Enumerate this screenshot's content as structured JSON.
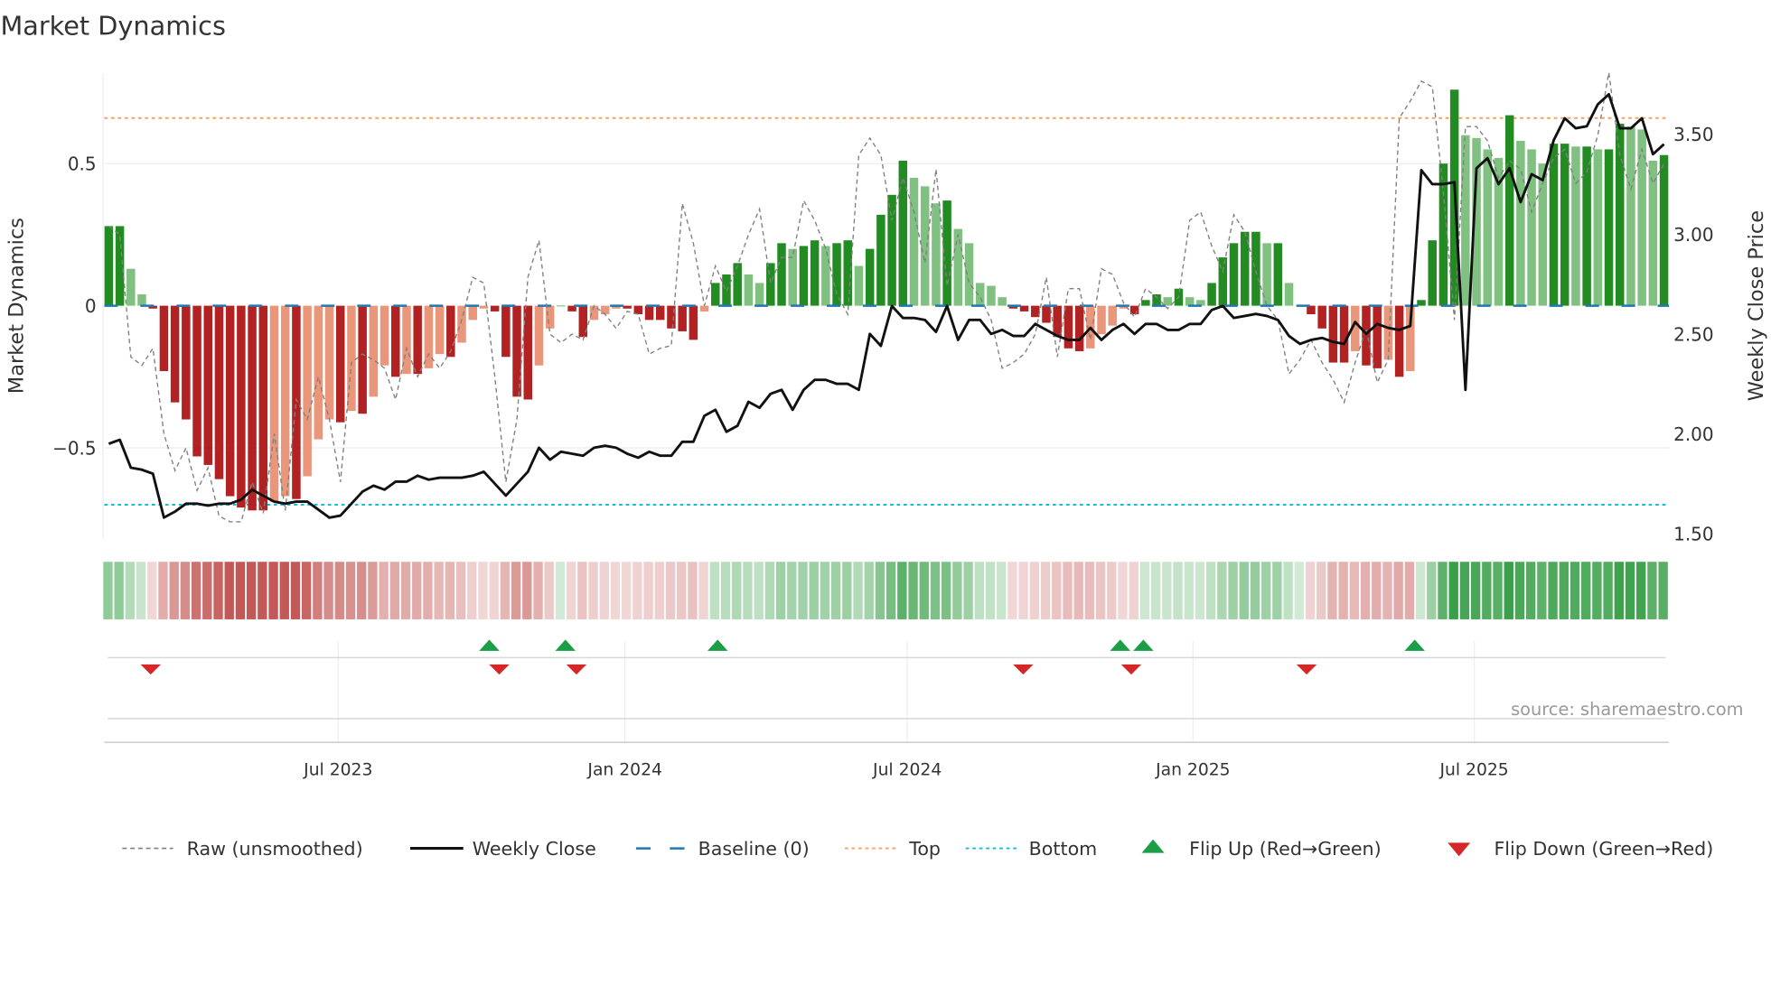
{
  "chart_data": {
    "type": "bar",
    "title": "Market Dynamics",
    "ylabel": "Market Dynamics",
    "y2label": "Weekly Close Price",
    "ylim": [
      -0.82,
      0.82
    ],
    "y2lim": [
      1.5,
      3.8
    ],
    "yticks": [
      {
        "v": 0.5,
        "label": "0.5"
      },
      {
        "v": 0,
        "label": "0"
      },
      {
        "v": -0.5,
        "label": "−0.5"
      }
    ],
    "y2ticks": [
      {
        "v": 3.5,
        "label": "3.50"
      },
      {
        "v": 3.0,
        "label": "3.00"
      },
      {
        "v": 2.5,
        "label": "2.50"
      },
      {
        "v": 2.0,
        "label": "2.00"
      },
      {
        "v": 1.5,
        "label": "1.50"
      }
    ],
    "xticks": [
      {
        "week": 20.8,
        "label": "Jul 2023"
      },
      {
        "week": 46.8,
        "label": "Jan 2024"
      },
      {
        "week": 72.4,
        "label": "Jul 2024"
      },
      {
        "week": 98.3,
        "label": "Jan 2025"
      },
      {
        "week": 123.8,
        "label": "Jul 2025"
      }
    ],
    "top_level": 0.66,
    "bottom_level": -0.7,
    "baseline": 0,
    "smoothed": [
      0.28,
      0.28,
      0.13,
      0.04,
      -0.01,
      -0.23,
      -0.34,
      -0.4,
      -0.53,
      -0.56,
      -0.61,
      -0.67,
      -0.71,
      -0.72,
      -0.72,
      -0.69,
      -0.67,
      -0.68,
      -0.6,
      -0.47,
      -0.4,
      -0.41,
      -0.37,
      -0.38,
      -0.32,
      -0.21,
      -0.25,
      -0.24,
      -0.24,
      -0.22,
      -0.17,
      -0.18,
      -0.13,
      -0.05,
      -0.01,
      -0.02,
      -0.18,
      -0.32,
      -0.33,
      -0.21,
      -0.08,
      0.0,
      -0.02,
      -0.11,
      -0.05,
      -0.03,
      -0.01,
      -0.01,
      -0.03,
      -0.05,
      -0.05,
      -0.08,
      -0.09,
      -0.12,
      -0.02,
      0.08,
      0.11,
      0.15,
      0.11,
      0.08,
      0.15,
      0.22,
      0.2,
      0.21,
      0.23,
      0.21,
      0.22,
      0.23,
      0.14,
      0.2,
      0.32,
      0.39,
      0.51,
      0.45,
      0.42,
      0.36,
      0.37,
      0.27,
      0.22,
      0.08,
      0.07,
      0.03,
      -0.01,
      -0.02,
      -0.04,
      -0.06,
      -0.11,
      -0.15,
      -0.16,
      -0.15,
      -0.1,
      -0.07,
      -0.01,
      -0.03,
      0.02,
      0.04,
      0.03,
      0.06,
      0.03,
      0.02,
      0.08,
      0.17,
      0.22,
      0.26,
      0.26,
      0.22,
      0.22,
      0.08,
      0.0,
      -0.03,
      -0.08,
      -0.2,
      -0.2,
      -0.16,
      -0.21,
      -0.22,
      -0.19,
      -0.25,
      -0.23,
      0.02,
      0.23,
      0.5,
      0.76,
      0.6,
      0.59,
      0.55,
      0.52,
      0.67,
      0.58,
      0.55,
      0.5,
      0.57,
      0.57,
      0.56,
      0.56,
      0.55,
      0.55,
      0.64,
      0.63,
      0.62,
      0.51,
      0.53
    ],
    "raw": [
      0.28,
      0.25,
      -0.18,
      -0.21,
      -0.15,
      -0.45,
      -0.58,
      -0.5,
      -0.65,
      -0.57,
      -0.74,
      -0.76,
      -0.76,
      -0.62,
      -0.73,
      -0.45,
      -0.72,
      -0.33,
      -0.4,
      -0.25,
      -0.4,
      -0.62,
      -0.2,
      -0.17,
      -0.19,
      -0.22,
      -0.33,
      -0.15,
      -0.25,
      -0.17,
      -0.22,
      -0.16,
      -0.05,
      0.1,
      0.08,
      -0.25,
      -0.62,
      -0.4,
      0.1,
      0.23,
      -0.1,
      -0.13,
      -0.1,
      -0.12,
      0.0,
      -0.03,
      -0.08,
      -0.02,
      -0.03,
      -0.17,
      -0.15,
      -0.14,
      0.36,
      0.22,
      0.0,
      0.14,
      0.05,
      0.14,
      0.25,
      0.34,
      0.08,
      0.17,
      0.17,
      0.37,
      0.3,
      0.2,
      0.04,
      -0.03,
      0.53,
      0.59,
      0.53,
      0.3,
      0.45,
      0.33,
      0.15,
      0.48,
      0.07,
      0.25,
      0.08,
      0.03,
      -0.05,
      -0.22,
      -0.2,
      -0.17,
      -0.1,
      0.1,
      -0.18,
      0.06,
      0.06,
      -0.12,
      0.13,
      0.11,
      0.01,
      -0.04,
      0.06,
      0.03,
      -0.01,
      0.03,
      0.3,
      0.33,
      0.21,
      0.12,
      0.32,
      0.26,
      0.12,
      0.0,
      -0.05,
      -0.24,
      -0.19,
      -0.12,
      -0.2,
      -0.26,
      -0.34,
      -0.2,
      -0.08,
      -0.27,
      -0.19,
      0.66,
      0.72,
      0.79,
      0.77,
      0.4,
      -0.05,
      0.63,
      0.63,
      0.58,
      0.45,
      0.51,
      0.48,
      0.33,
      0.43,
      0.52,
      0.55,
      0.43,
      0.47,
      0.6,
      0.82,
      0.53,
      0.41,
      0.55,
      0.43,
      0.5
    ],
    "weekly_close": [
      1.95,
      1.97,
      1.83,
      1.82,
      1.8,
      1.58,
      1.61,
      1.65,
      1.65,
      1.64,
      1.65,
      1.65,
      1.67,
      1.72,
      1.69,
      1.66,
      1.65,
      1.66,
      1.66,
      1.62,
      1.58,
      1.59,
      1.65,
      1.71,
      1.74,
      1.72,
      1.76,
      1.76,
      1.79,
      1.77,
      1.78,
      1.78,
      1.78,
      1.79,
      1.81,
      1.75,
      1.69,
      1.75,
      1.81,
      1.93,
      1.87,
      1.91,
      1.9,
      1.89,
      1.93,
      1.94,
      1.93,
      1.9,
      1.88,
      1.91,
      1.89,
      1.89,
      1.96,
      1.96,
      2.09,
      2.12,
      2.01,
      2.04,
      2.16,
      2.13,
      2.2,
      2.22,
      2.12,
      2.22,
      2.27,
      2.27,
      2.25,
      2.25,
      2.22,
      2.5,
      2.44,
      2.64,
      2.58,
      2.58,
      2.57,
      2.51,
      2.64,
      2.47,
      2.57,
      2.57,
      2.5,
      2.52,
      2.49,
      2.49,
      2.55,
      2.52,
      2.49,
      2.47,
      2.47,
      2.53,
      2.47,
      2.52,
      2.55,
      2.5,
      2.55,
      2.55,
      2.52,
      2.52,
      2.55,
      2.55,
      2.62,
      2.64,
      2.58,
      2.59,
      2.6,
      2.59,
      2.57,
      2.49,
      2.45,
      2.47,
      2.48,
      2.46,
      2.45,
      2.56,
      2.5,
      2.55,
      2.53,
      2.52,
      2.54,
      3.32,
      3.25,
      3.25,
      3.26,
      2.22,
      3.33,
      3.38,
      3.25,
      3.33,
      3.16,
      3.3,
      3.27,
      3.47,
      3.58,
      3.53,
      3.54,
      3.65,
      3.7,
      3.53,
      3.53,
      3.58,
      3.4,
      3.45
    ],
    "flip_up_weeks": [
      34.5,
      41.4,
      55.2,
      91.7,
      93.8,
      118.4
    ],
    "flip_down_weeks": [
      3.8,
      35.4,
      42.4,
      82.9,
      92.7,
      108.6
    ],
    "colors": {
      "pos_rising": "#228b22",
      "pos_falling": "#80c080",
      "neg_falling": "#b22222",
      "neg_rising": "#e9967a",
      "raw": "#808080",
      "close": "#111111",
      "baseline": "#1f77b4",
      "top": "#f4a460",
      "bottom": "#17becf",
      "strip_green": "#2e9a3e",
      "strip_red": "#c0504d",
      "flip_up": "#1a9e46",
      "flip_down": "#d62728"
    },
    "legend": {
      "placement": "bottom",
      "items": [
        {
          "key": "raw",
          "label": "Raw (unsmoothed)"
        },
        {
          "key": "close",
          "label": "Weekly Close"
        },
        {
          "key": "baseline",
          "label": "Baseline (0)"
        },
        {
          "key": "top",
          "label": "Top"
        },
        {
          "key": "bottom",
          "label": "Bottom"
        },
        {
          "key": "flip_up",
          "label": "Flip Up (Red→Green)"
        },
        {
          "key": "flip_down",
          "label": "Flip Down (Green→Red)"
        }
      ]
    },
    "source": "source: sharemaestro.com"
  }
}
